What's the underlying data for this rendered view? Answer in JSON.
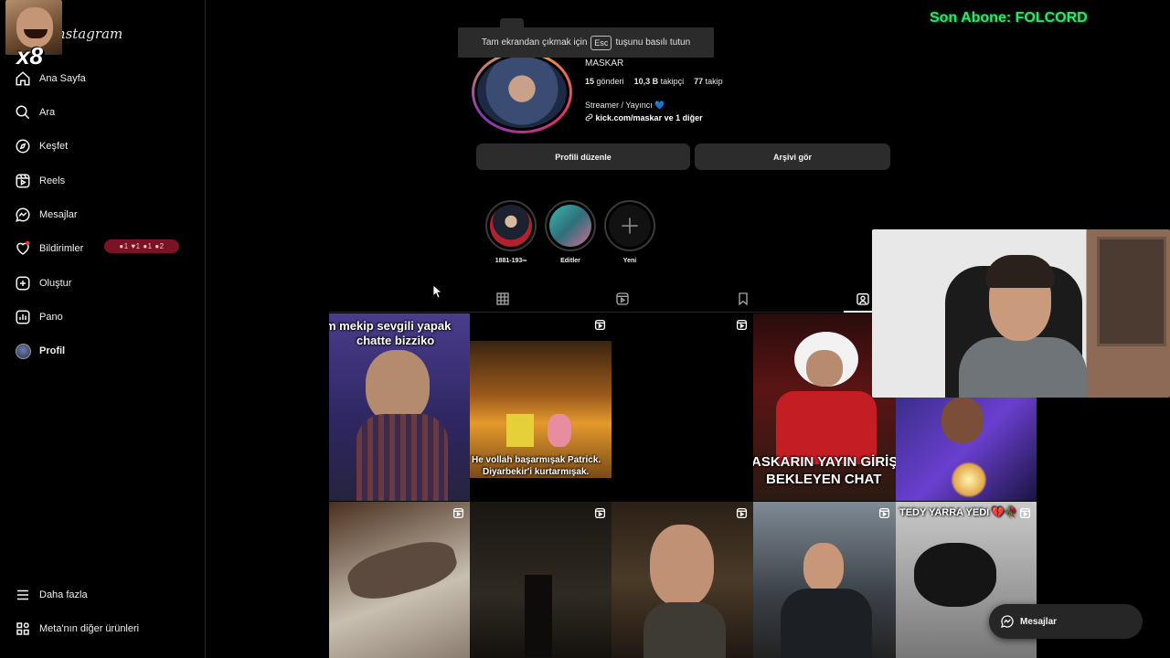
{
  "sidebar": {
    "brand": "Instagram",
    "items": [
      {
        "label": "Ana Sayfa",
        "icon": "home-icon"
      },
      {
        "label": "Ara",
        "icon": "search-icon"
      },
      {
        "label": "Keşfet",
        "icon": "compass-icon"
      },
      {
        "label": "Reels",
        "icon": "reels-icon"
      },
      {
        "label": "Mesajlar",
        "icon": "messenger-icon"
      },
      {
        "label": "Bildirimler",
        "icon": "heart-icon"
      },
      {
        "label": "Oluştur",
        "icon": "plus-square-icon"
      },
      {
        "label": "Pano",
        "icon": "chart-icon"
      },
      {
        "label": "Profil",
        "icon": "avatar"
      }
    ],
    "notification_counts": "●1 ♥1 ●1 ●2",
    "more_label": "Daha fazla",
    "meta_label": "Meta'nın diğer ürünleri"
  },
  "overlay": {
    "emote_multiplier": "x8",
    "last_sub": "Son Abone: FOLCORD"
  },
  "fullscreen_tip": {
    "before": "Tam ekrandan çıkmak için",
    "key": "Esc",
    "after": "tuşunu basılı tutun"
  },
  "profile": {
    "name": "MASKAR",
    "posts": "15",
    "posts_label": "gönderi",
    "followers": "10,3 B",
    "followers_label": "takipçi",
    "following": "77",
    "following_label": "takip",
    "bio": "Streamer / Yayıncı",
    "link": "kick.com/maskar ve 1 diğer",
    "edit_button": "Profili düzenle",
    "archive_button": "Arşivi gör"
  },
  "highlights": [
    {
      "label": "1881-193∞"
    },
    {
      "label": "Editler"
    },
    {
      "label": "Yeni"
    }
  ],
  "grid_captions": {
    "tile1": "m mekip sevgili yapak",
    "tile1b": "chatte bizziko",
    "tile2": "He vollah başarmışak Patrick.",
    "tile2b": "Diyarbekir'i kurtarmışak.",
    "tile4": "ASKARIN YAYIN GİRİŞ",
    "tile4b": "BEKLEYEN CHAT",
    "tile10": "TEDY YARRA YEDI 💔🥀"
  },
  "messages_pill": "Mesajlar"
}
